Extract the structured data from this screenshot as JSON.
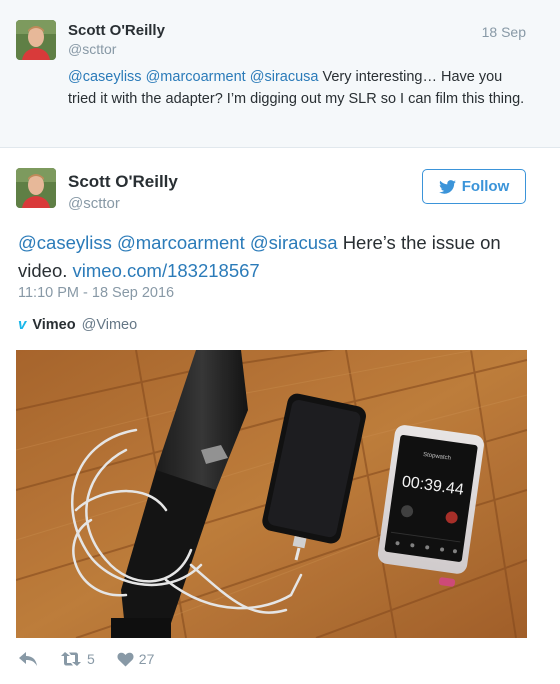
{
  "parent_tweet": {
    "author_name": "Scott O'Reilly",
    "author_handle": "@scttor",
    "date": "18 Sep",
    "mentions": [
      "@caseyliss",
      "@marcoarment",
      "@siracusa"
    ],
    "text": "Very interesting… Have you tried it with the adapter? I’m digging out my SLR so I can film this thing."
  },
  "main_tweet": {
    "author_name": "Scott O'Reilly",
    "author_handle": "@scttor",
    "follow_label": "Follow",
    "mentions": [
      "@caseyliss",
      "@marcoarment",
      "@siracusa"
    ],
    "text_before_link": "Here’s the issue on video.",
    "link": "vimeo.com/183218567",
    "timestamp": "11:10 PM - 18 Sep 2016",
    "source": {
      "icon": "v",
      "name": "Vimeo",
      "handle": "@Vimeo"
    },
    "media": {
      "stopwatch_reading": "00:39.44"
    },
    "actions": {
      "retweets": "5",
      "likes": "27"
    }
  },
  "colors": {
    "link": "#2b7bb9",
    "follow": "#3b94d9",
    "muted": "#8899a6",
    "vimeo": "#1ab7ea"
  }
}
